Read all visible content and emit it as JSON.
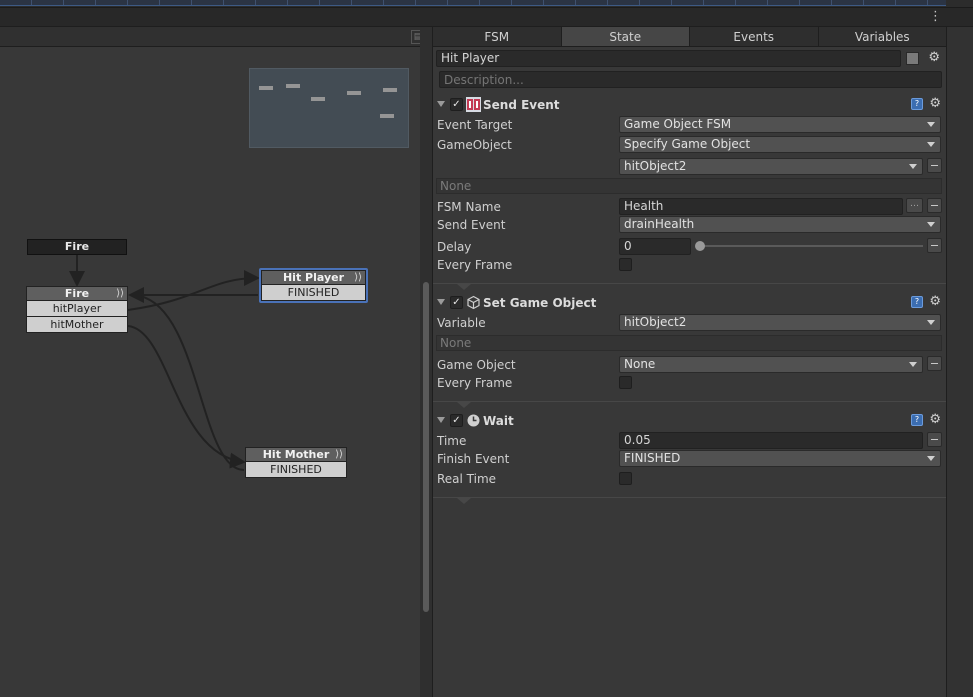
{
  "colors": {
    "selected_node_outline": "#4a72b8",
    "background": "#383838",
    "accent_help": "#3b6db1"
  },
  "toolbar": {
    "menu_icon": "kebab-menu-icon"
  },
  "graph": {
    "start_event": "Fire",
    "nodes": {
      "fire": {
        "title": "Fire",
        "transitions": [
          "hitPlayer",
          "hitMother"
        ]
      },
      "hit_player": {
        "title": "Hit Player",
        "transitions": [
          "FINISHED"
        ],
        "selected": true
      },
      "hit_mother": {
        "title": "Hit Mother",
        "transitions": [
          "FINISHED"
        ]
      }
    }
  },
  "inspector": {
    "tabs": [
      "FSM",
      "State",
      "Events",
      "Variables"
    ],
    "active_tab": "State",
    "state_name": "Hit Player",
    "description_placeholder": "Description...",
    "actions": {
      "send_event": {
        "title": "Send Event",
        "enabled": true,
        "event_target_label": "Event Target",
        "event_target_value": "Game Object FSM",
        "gameobject_label": "GameObject",
        "gameobject_value": "Specify Game Object",
        "variable_value": "hitObject2",
        "none_text": "None",
        "fsm_name_label": "FSM Name",
        "fsm_name_value": "Health",
        "send_event_label": "Send Event",
        "send_event_value": "drainHealth",
        "delay_label": "Delay",
        "delay_value": "0",
        "every_frame_label": "Every Frame"
      },
      "set_game_object": {
        "title": "Set Game Object",
        "enabled": true,
        "variable_label": "Variable",
        "variable_value": "hitObject2",
        "none_text": "None",
        "game_object_label": "Game Object",
        "game_object_value": "None",
        "every_frame_label": "Every Frame"
      },
      "wait": {
        "title": "Wait",
        "enabled": true,
        "time_label": "Time",
        "time_value": "0.05",
        "finish_event_label": "Finish Event",
        "finish_event_value": "FINISHED",
        "real_time_label": "Real Time"
      }
    }
  }
}
